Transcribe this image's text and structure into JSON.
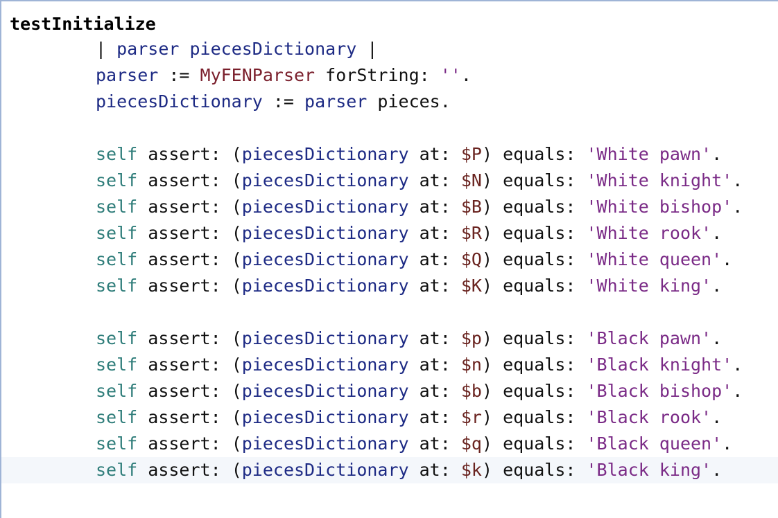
{
  "method": {
    "selector": "testInitialize"
  },
  "temps": {
    "open_bar": "| ",
    "parser": "parser",
    "space": " ",
    "pieces_dictionary": "piecesDictionary",
    "close_bar": " |"
  },
  "assign1": {
    "var": "parser",
    "op": " := ",
    "cls": "MyFENParser",
    "msg": " forString: ",
    "str": "''",
    "end": "."
  },
  "assign2": {
    "var": "piecesDictionary",
    "op": " := ",
    "recv": "parser",
    "msg": " pieces",
    "end": "."
  },
  "asserts_white": [
    {
      "self": "self",
      "assert": " assert: ",
      "open": "(",
      "dict": "piecesDictionary",
      "at": " at: ",
      "chr": "$P",
      "close": ")",
      "equals": " equals: ",
      "str": "'White pawn'",
      "end": "."
    },
    {
      "self": "self",
      "assert": " assert: ",
      "open": "(",
      "dict": "piecesDictionary",
      "at": " at: ",
      "chr": "$N",
      "close": ")",
      "equals": " equals: ",
      "str": "'White knight'",
      "end": "."
    },
    {
      "self": "self",
      "assert": " assert: ",
      "open": "(",
      "dict": "piecesDictionary",
      "at": " at: ",
      "chr": "$B",
      "close": ")",
      "equals": " equals: ",
      "str": "'White bishop'",
      "end": "."
    },
    {
      "self": "self",
      "assert": " assert: ",
      "open": "(",
      "dict": "piecesDictionary",
      "at": " at: ",
      "chr": "$R",
      "close": ")",
      "equals": " equals: ",
      "str": "'White rook'",
      "end": "."
    },
    {
      "self": "self",
      "assert": " assert: ",
      "open": "(",
      "dict": "piecesDictionary",
      "at": " at: ",
      "chr": "$Q",
      "close": ")",
      "equals": " equals: ",
      "str": "'White queen'",
      "end": "."
    },
    {
      "self": "self",
      "assert": " assert: ",
      "open": "(",
      "dict": "piecesDictionary",
      "at": " at: ",
      "chr": "$K",
      "close": ")",
      "equals": " equals: ",
      "str": "'White king'",
      "end": "."
    }
  ],
  "asserts_black": [
    {
      "self": "self",
      "assert": " assert: ",
      "open": "(",
      "dict": "piecesDictionary",
      "at": " at: ",
      "chr": "$p",
      "close": ")",
      "equals": " equals: ",
      "str": "'Black pawn'",
      "end": "."
    },
    {
      "self": "self",
      "assert": " assert: ",
      "open": "(",
      "dict": "piecesDictionary",
      "at": " at: ",
      "chr": "$n",
      "close": ")",
      "equals": " equals: ",
      "str": "'Black knight'",
      "end": "."
    },
    {
      "self": "self",
      "assert": " assert: ",
      "open": "(",
      "dict": "piecesDictionary",
      "at": " at: ",
      "chr": "$b",
      "close": ")",
      "equals": " equals: ",
      "str": "'Black bishop'",
      "end": "."
    },
    {
      "self": "self",
      "assert": " assert: ",
      "open": "(",
      "dict": "piecesDictionary",
      "at": " at: ",
      "chr": "$r",
      "close": ")",
      "equals": " equals: ",
      "str": "'Black rook'",
      "end": "."
    },
    {
      "self": "self",
      "assert": " assert: ",
      "open": "(",
      "dict": "piecesDictionary",
      "at": " at: ",
      "chr": "$q",
      "close": ")",
      "equals": " equals: ",
      "str": "'Black queen'",
      "end": "."
    },
    {
      "self": "self",
      "assert": " assert: ",
      "open": "(",
      "dict": "piecesDictionary",
      "at": " at: ",
      "chr": "$k",
      "close": ")",
      "equals": " equals: ",
      "str": "'Black king'",
      "end": "."
    }
  ],
  "colors": {
    "temp_var": "#1d2a84",
    "class_ref": "#7a1f2c",
    "string": "#7a2a86",
    "character": "#6a2420",
    "self": "#2f7d7a",
    "border": "#9fb4d6"
  }
}
